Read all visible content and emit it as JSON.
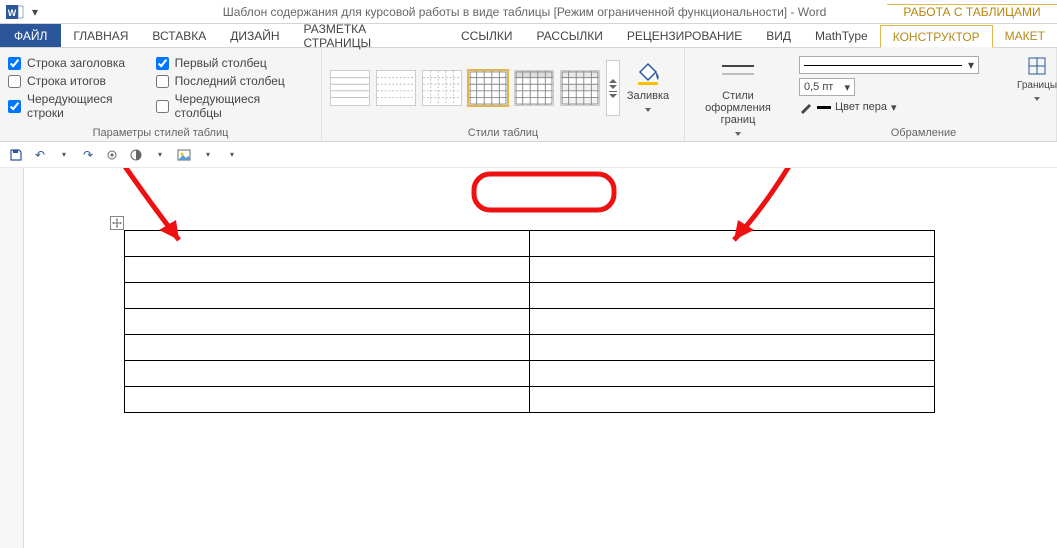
{
  "title": "Шаблон содержания для курсовой работы в виде таблицы [Режим ограниченной функциональности] - Word",
  "context_title": "РАБОТА С ТАБЛИЦАМИ",
  "tabs": {
    "file": "ФАЙЛ",
    "home": "ГЛАВНАЯ",
    "insert": "ВСТАВКА",
    "design": "ДИЗАЙН",
    "layoutpage": "РАЗМЕТКА СТРАНИЦЫ",
    "references": "ССЫЛКИ",
    "mailings": "РАССЫЛКИ",
    "review": "РЕЦЕНЗИРОВАНИЕ",
    "view": "ВИД",
    "mathtype": "MathType",
    "ctx_design": "КОНСТРУКТОР",
    "ctx_layout": "МАКЕТ"
  },
  "group_labels": {
    "style_options": "Параметры стилей таблиц",
    "table_styles": "Стили таблиц",
    "borders": "Обрамление"
  },
  "style_options": {
    "header_row": "Строка заголовка",
    "total_row": "Строка итогов",
    "banded_rows": "Чередующиеся строки",
    "first_col": "Первый столбец",
    "last_col": "Последний столбец",
    "banded_cols": "Чередующиеся столбцы"
  },
  "shading_label": "Заливка",
  "border_styles_label": "Стили оформления границ",
  "line_weight": "0,5 пт",
  "pen_color_label": "Цвет пера",
  "borders_btn": "Границы",
  "table": {
    "rows": 7,
    "cols": 2
  }
}
